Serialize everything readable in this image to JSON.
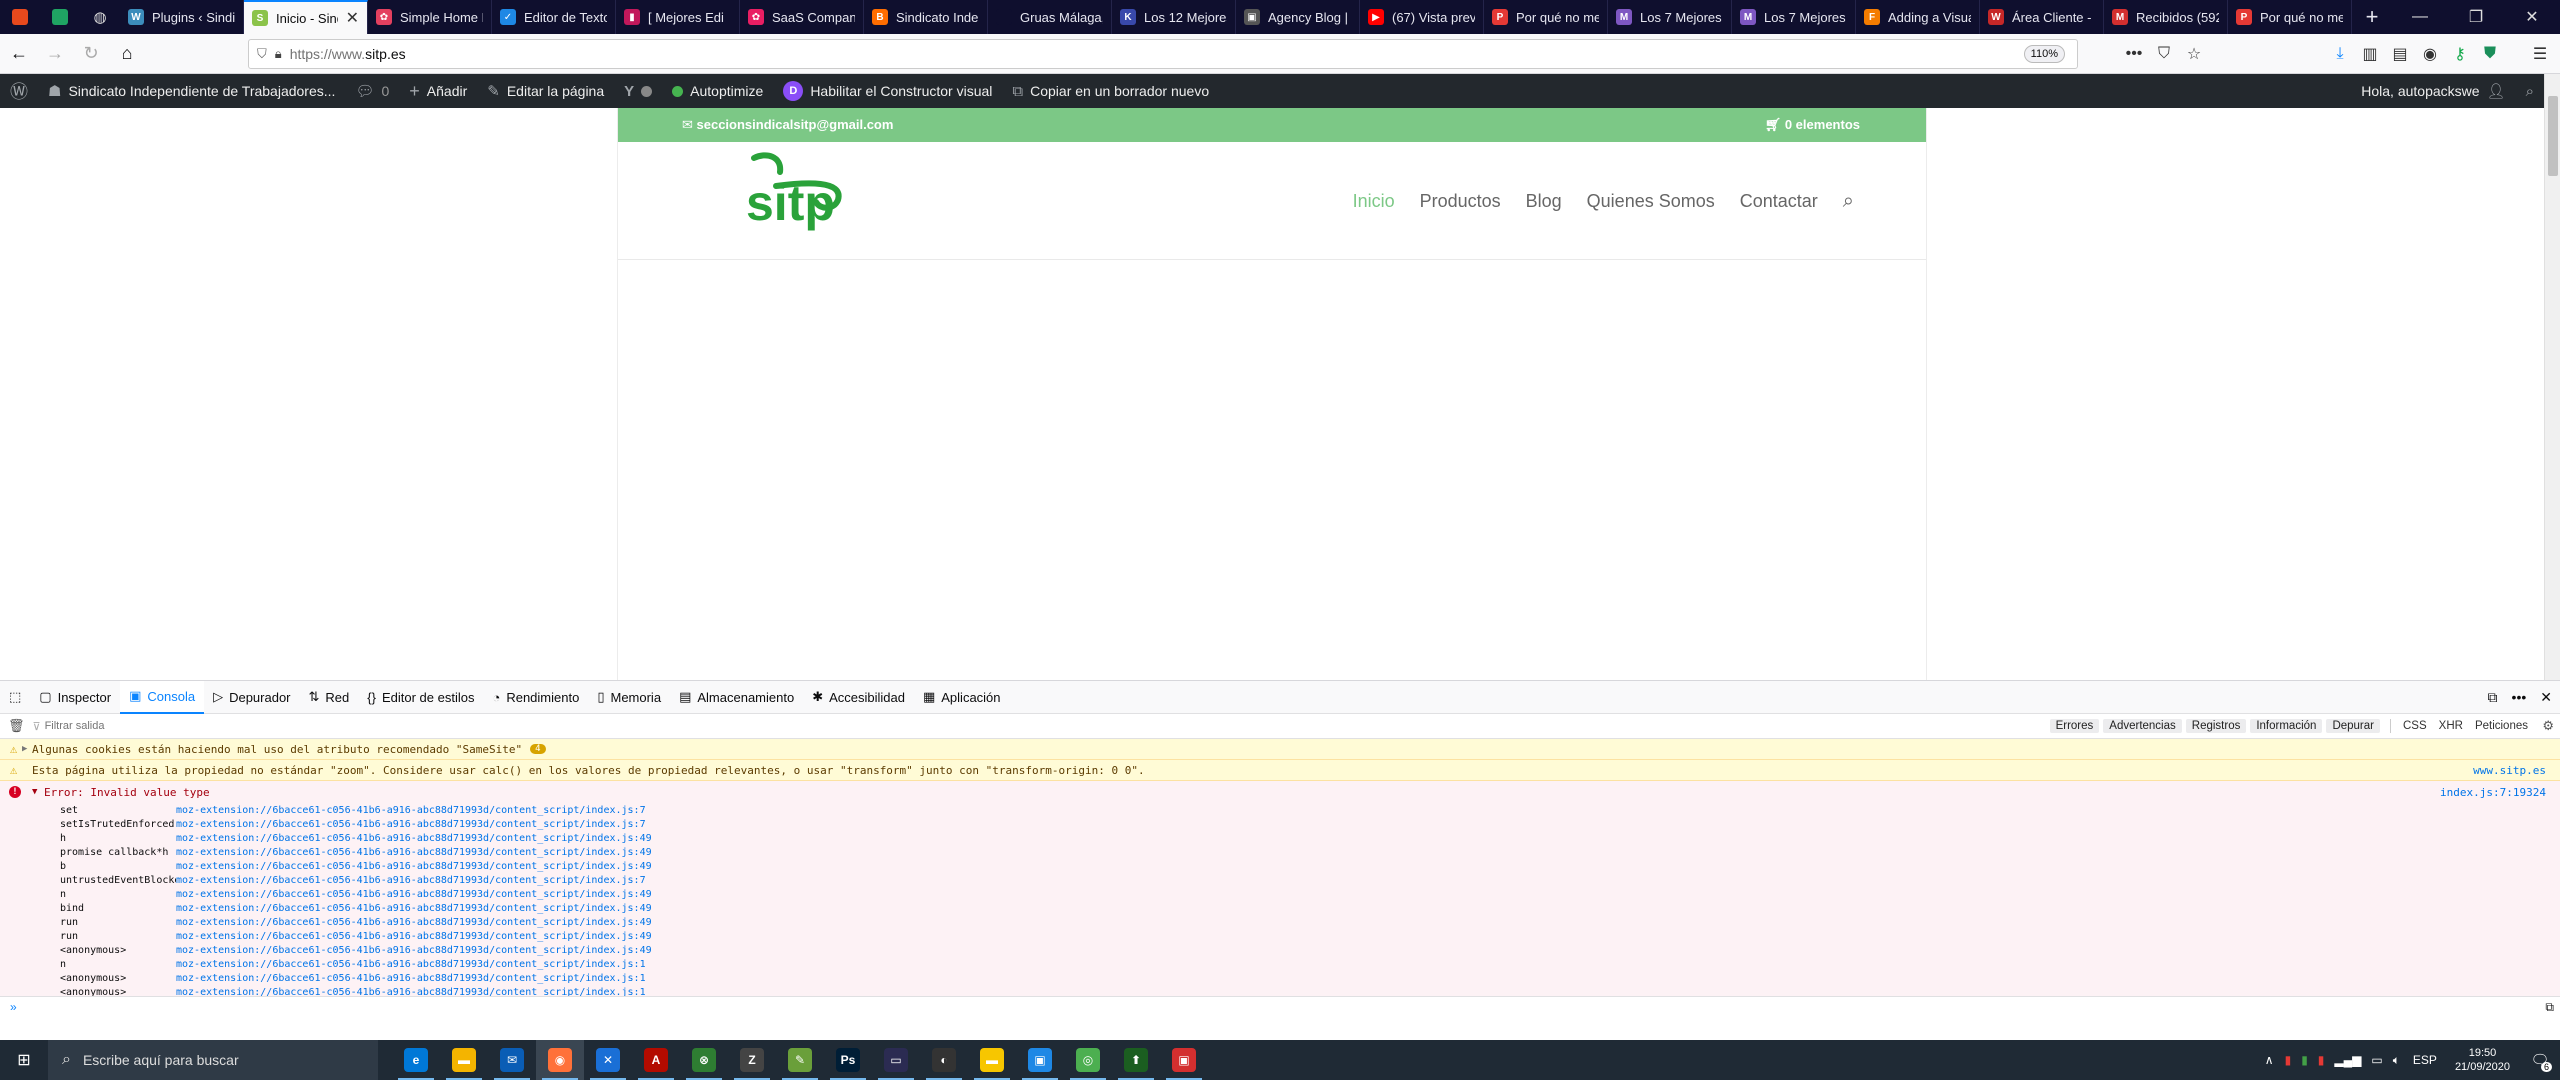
{
  "browser": {
    "tabs": [
      {
        "title": "Plugins ‹ Sindi",
        "fav_color": "#3c8dbc",
        "fav_glyph": "W"
      },
      {
        "title": "Inicio - Sindi",
        "fav_color": "#8bc34a",
        "fav_glyph": "S",
        "active": true
      },
      {
        "title": "Simple Home P",
        "fav_color": "#e4405f",
        "fav_glyph": "✿"
      },
      {
        "title": "Editor de Texto",
        "fav_color": "#1e88e5",
        "fav_glyph": "✓"
      },
      {
        "title": "[ Mejores Edi",
        "fav_color": "#c2185b",
        "fav_glyph": "▮"
      },
      {
        "title": "SaaS Company",
        "fav_color": "#e91e63",
        "fav_glyph": "✿"
      },
      {
        "title": "Sindicato Indep",
        "fav_color": "#ff6d00",
        "fav_glyph": "B"
      },
      {
        "title": "Gruas Málaga, desd",
        "fav_color": "#0f0f2e",
        "fav_glyph": ""
      },
      {
        "title": "Los 12 Mejores",
        "fav_color": "#3949ab",
        "fav_glyph": "K"
      },
      {
        "title": "Agency Blog | D",
        "fav_color": "#555555",
        "fav_glyph": "▣"
      },
      {
        "title": "(67) Vista previ",
        "fav_color": "#ff0000",
        "fav_glyph": "▶"
      },
      {
        "title": "Por qué no me",
        "fav_color": "#e53935",
        "fav_glyph": "P"
      },
      {
        "title": "Los 7 Mejores P",
        "fav_color": "#7e57c2",
        "fav_glyph": "M"
      },
      {
        "title": "Los 7 Mejores P",
        "fav_color": "#7e57c2",
        "fav_glyph": "M"
      },
      {
        "title": "Adding a Visua",
        "fav_color": "#f57c00",
        "fav_glyph": "F"
      },
      {
        "title": "Área Cliente - V",
        "fav_color": "#c62828",
        "fav_glyph": "W"
      },
      {
        "title": "Recibidos (592)",
        "fav_color": "#d32f2f",
        "fav_glyph": "M"
      },
      {
        "title": "Por qué no me",
        "fav_color": "#e53935",
        "fav_glyph": "P"
      }
    ],
    "url_prefix": "https://www.",
    "url_domain": "sitp.es",
    "zoom": "110%"
  },
  "wp_admin_bar": {
    "site_name": "Sindicato Independiente de Trabajadores...",
    "comments_count": "0",
    "add_new": "Añadir",
    "edit_page": "Editar la página",
    "autoptimize": "Autoptimize",
    "visual_builder": "Habilitar el Constructor visual",
    "copy_draft": "Copiar en un borrador nuevo",
    "greeting": "Hola, autopackswe"
  },
  "site": {
    "email": "seccionsindicalsitp@gmail.com",
    "cart": "0 elementos",
    "logo_text": "sitp",
    "menu": [
      "Inicio",
      "Productos",
      "Blog",
      "Quienes Somos",
      "Contactar"
    ],
    "brand_color": "#7cc886",
    "logo_color": "#2aa23a"
  },
  "devtools": {
    "tabs": [
      "Inspector",
      "Consola",
      "Depurador",
      "Red",
      "Editor de estilos",
      "Rendimiento",
      "Memoria",
      "Almacenamiento",
      "Accesibilidad",
      "Aplicación"
    ],
    "active_tab": "Consola",
    "filter_placeholder": "Filtrar salida",
    "filter_buttons": [
      "Errores",
      "Advertencias",
      "Registros",
      "Información",
      "Depurar"
    ],
    "filter_plain": [
      "CSS",
      "XHR",
      "Peticiones"
    ],
    "messages": {
      "warning1": "Algunas cookies están haciendo mal uso del atributo recomendado \"SameSite\"",
      "warning1_count": "4",
      "warning2": "Esta página utiliza la propiedad no estándar \"zoom\". Considere usar calc() en los valores de propiedad relevantes, o usar \"transform\" junto con \"transform-origin: 0 0\".",
      "warning2_source": "www.sitp.es",
      "error": "Error: Invalid value type",
      "error_source": "index.js:7:19324"
    },
    "stack": [
      {
        "fn": "set",
        "loc": "moz-extension://6bacce61-c056-41b6-a916-abc88d71993d/content_script/index.js:7"
      },
      {
        "fn": "setIsTrutedEnforced",
        "loc": "moz-extension://6bacce61-c056-41b6-a916-abc88d71993d/content_script/index.js:7"
      },
      {
        "fn": "h",
        "loc": "moz-extension://6bacce61-c056-41b6-a916-abc88d71993d/content_script/index.js:49"
      },
      {
        "fn": "promise callback*h",
        "loc": "moz-extension://6bacce61-c056-41b6-a916-abc88d71993d/content_script/index.js:49"
      },
      {
        "fn": "b",
        "loc": "moz-extension://6bacce61-c056-41b6-a916-abc88d71993d/content_script/index.js:49"
      },
      {
        "fn": "untrustedEventBlockerWrapper",
        "loc": "moz-extension://6bacce61-c056-41b6-a916-abc88d71993d/content_script/index.js:7"
      },
      {
        "fn": "n",
        "loc": "moz-extension://6bacce61-c056-41b6-a916-abc88d71993d/content_script/index.js:49"
      },
      {
        "fn": "bind",
        "loc": "moz-extension://6bacce61-c056-41b6-a916-abc88d71993d/content_script/index.js:49"
      },
      {
        "fn": "run",
        "loc": "moz-extension://6bacce61-c056-41b6-a916-abc88d71993d/content_script/index.js:49"
      },
      {
        "fn": "run",
        "loc": "moz-extension://6bacce61-c056-41b6-a916-abc88d71993d/content_script/index.js:49"
      },
      {
        "fn": "<anonymous>",
        "loc": "moz-extension://6bacce61-c056-41b6-a916-abc88d71993d/content_script/index.js:49"
      },
      {
        "fn": "n",
        "loc": "moz-extension://6bacce61-c056-41b6-a916-abc88d71993d/content_script/index.js:1"
      },
      {
        "fn": "<anonymous>",
        "loc": "moz-extension://6bacce61-c056-41b6-a916-abc88d71993d/content_script/index.js:1"
      },
      {
        "fn": "<anonymous>",
        "loc": "moz-extension://6bacce61-c056-41b6-a916-abc88d71993d/content_script/index.js:1"
      }
    ]
  },
  "taskbar": {
    "search_placeholder": "Escribe aquí para buscar",
    "apps": [
      {
        "name": "edge",
        "color": "#0078d7",
        "glyph": "e"
      },
      {
        "name": "explorer",
        "color": "#f4b400",
        "glyph": "▬"
      },
      {
        "name": "mail",
        "color": "#0a5db5",
        "glyph": "✉"
      },
      {
        "name": "firefox",
        "color": "#ff7139",
        "glyph": "◉",
        "active": true
      },
      {
        "name": "xmind",
        "color": "#1a6fd6",
        "glyph": "✕"
      },
      {
        "name": "acrobat",
        "color": "#b30b00",
        "glyph": "A"
      },
      {
        "name": "xbox",
        "color": "#2e7d32",
        "glyph": "⊗"
      },
      {
        "name": "winzip",
        "color": "#444444",
        "glyph": "Z"
      },
      {
        "name": "notepad",
        "color": "#6a9f3a",
        "glyph": "✎"
      },
      {
        "name": "photoshop",
        "color": "#001e36",
        "glyph": "Ps"
      },
      {
        "name": "terminal",
        "color": "#2b2b52",
        "glyph": "▭"
      },
      {
        "name": "obs",
        "color": "#333333",
        "glyph": "◐"
      },
      {
        "name": "sticky-notes",
        "color": "#f7c600",
        "glyph": "▬"
      },
      {
        "name": "remote",
        "color": "#1e88e5",
        "glyph": "▣"
      },
      {
        "name": "chrome",
        "color": "#4caf50",
        "glyph": "◎"
      },
      {
        "name": "vpn",
        "color": "#1b5e20",
        "glyph": "⬆"
      },
      {
        "name": "app-red",
        "color": "#d32f2f",
        "glyph": "▣"
      }
    ],
    "lang": "ESP",
    "time": "19:50",
    "date": "21/09/2020",
    "notif_count": "6"
  }
}
